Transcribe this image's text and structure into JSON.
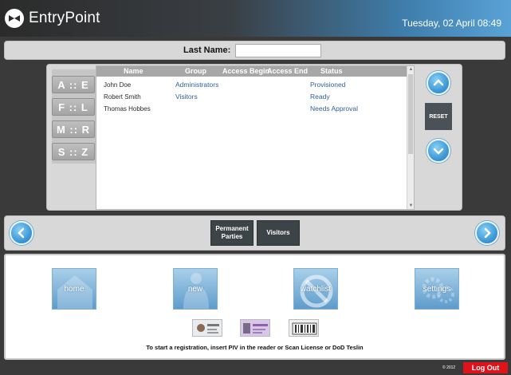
{
  "app": {
    "name": "EntryPoint",
    "datetime": "Tuesday, 02 April 08:49"
  },
  "search": {
    "label": "Last Name:",
    "value": "",
    "placeholder": ""
  },
  "alpha_filters": [
    "A :: E",
    "F :: L",
    "M :: R",
    "S :: Z"
  ],
  "table": {
    "columns": [
      "Name",
      "Group",
      "Access Begin",
      "Access End",
      "Status"
    ],
    "rows": [
      {
        "name": "John Doe",
        "group": "Administrators",
        "begin": "",
        "end": "",
        "status": "Provisioned"
      },
      {
        "name": "Robert Smith",
        "group": "Visitors",
        "begin": "",
        "end": "",
        "status": "Ready"
      },
      {
        "name": "Thomas Hobbes",
        "group": "",
        "begin": "",
        "end": "",
        "status": "Needs Approval"
      }
    ]
  },
  "controls": {
    "reset_label": "RESET"
  },
  "tabs": [
    {
      "label": "Permanent Parties"
    },
    {
      "label": "Visitors"
    }
  ],
  "tiles": [
    {
      "label": "home",
      "icon": "house-icon"
    },
    {
      "label": "new",
      "icon": "person-icon"
    },
    {
      "label": "watchlist",
      "icon": "no-entry-icon"
    },
    {
      "label": "settings",
      "icon": "gears-icon"
    }
  ],
  "hint": "To start a registration, insert PIV in the reader or Scan License or DoD Teslin",
  "footer": {
    "copyright": "© 2012",
    "logout_label": "Log Out"
  },
  "colors": {
    "accent": "#3f9ad8",
    "dark_button": "#3d4448",
    "logout": "#e0121a"
  }
}
